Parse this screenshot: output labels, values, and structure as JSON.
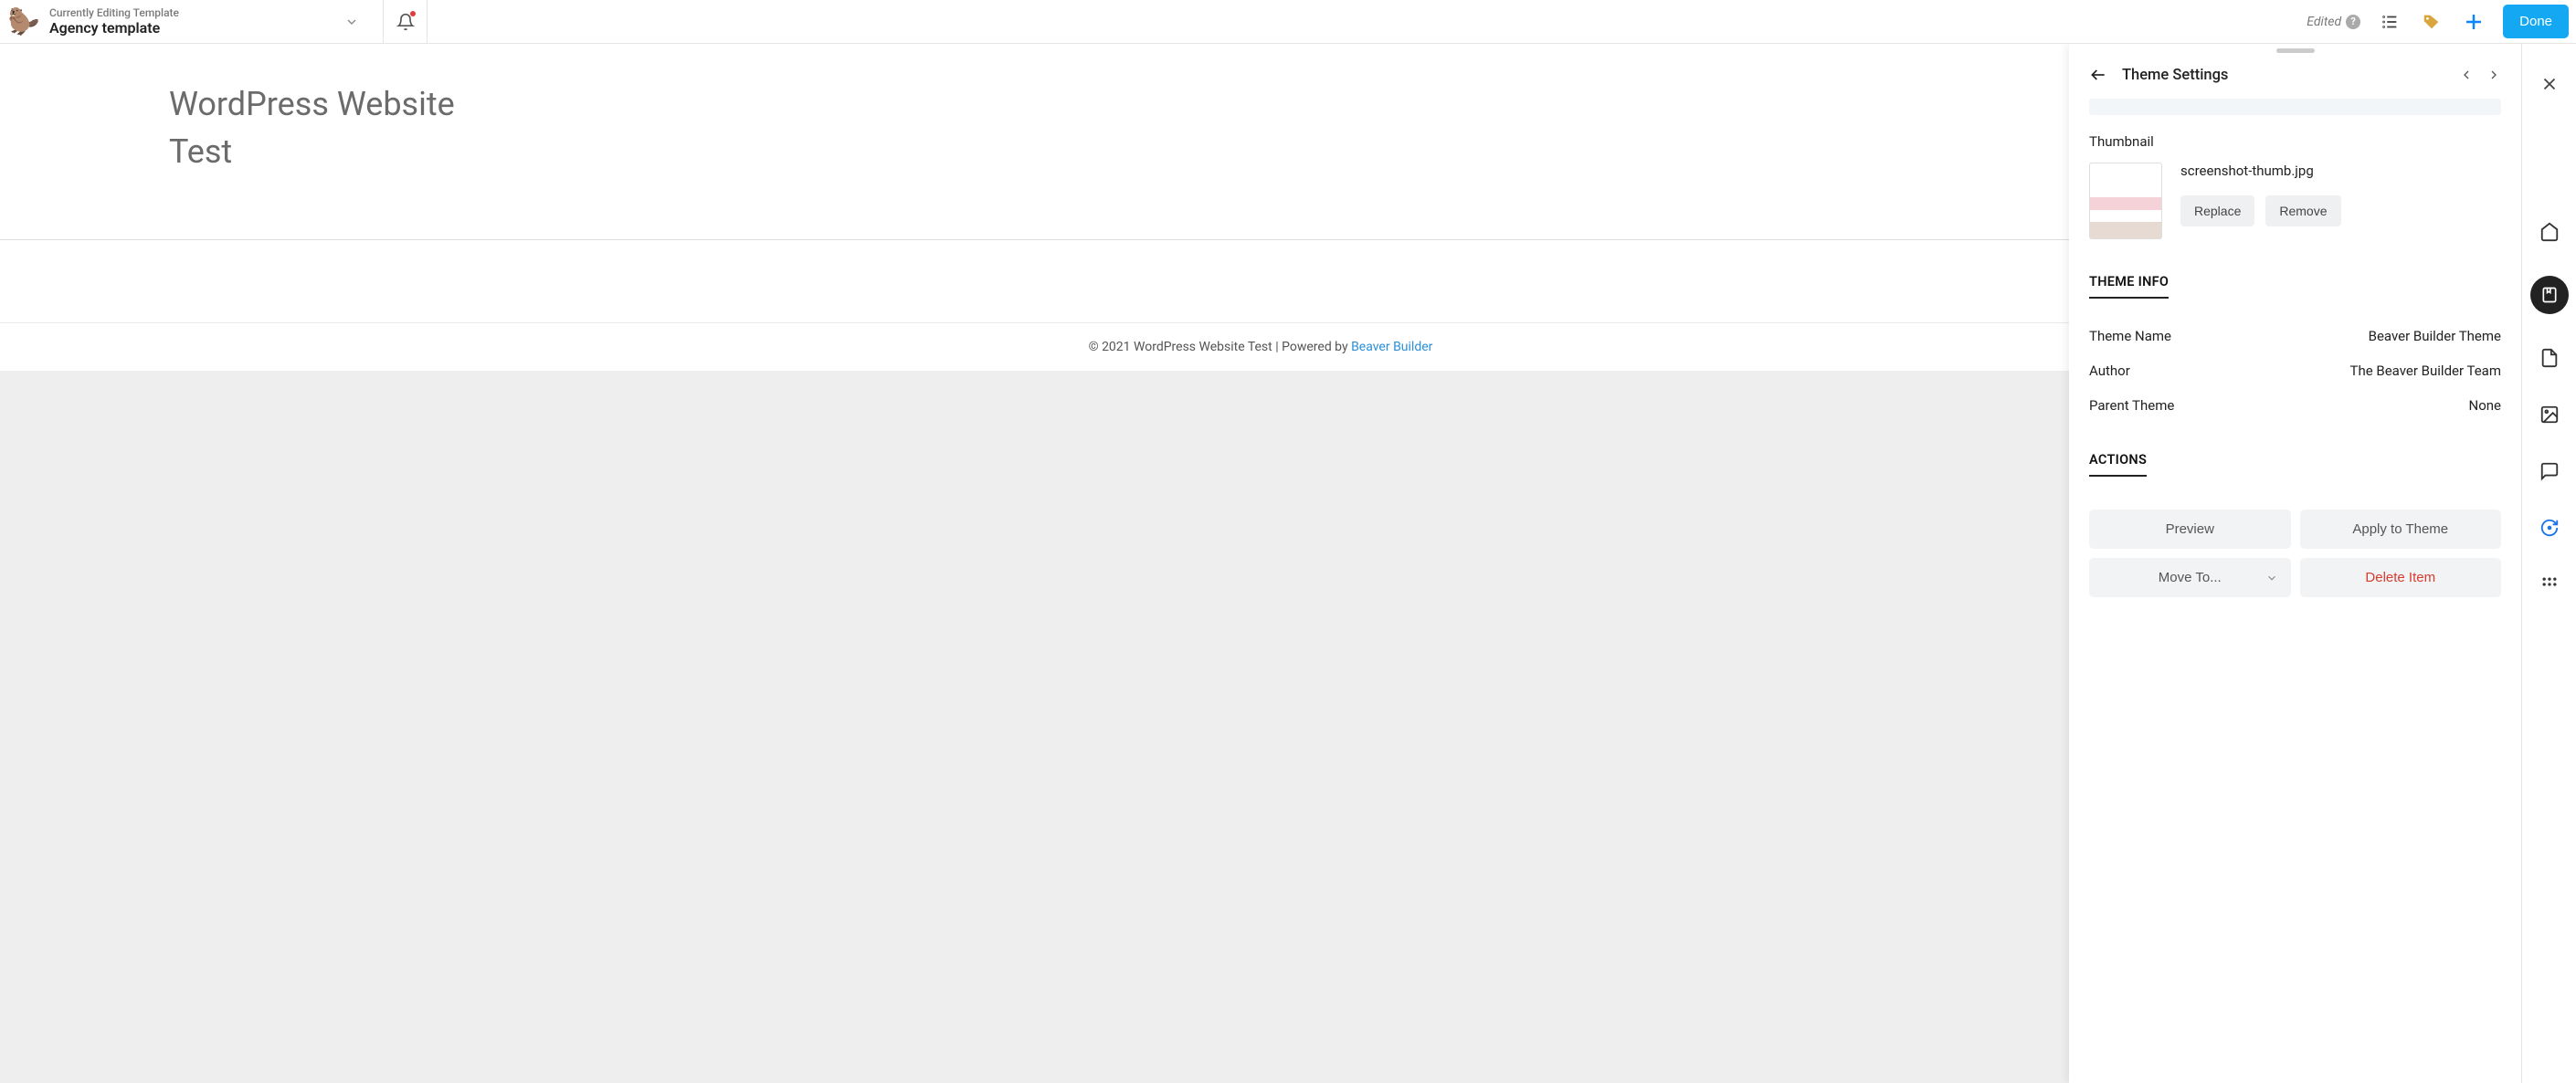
{
  "topbar": {
    "eyebrow": "Currently Editing Template",
    "title": "Agency template",
    "edited_label": "Edited",
    "done_label": "Done"
  },
  "preview": {
    "heading_line1": "WordPress Website",
    "heading_line2": "Test",
    "footer_text": "© 2021 WordPress Website Test | Powered by ",
    "footer_link": "Beaver Builder"
  },
  "panel": {
    "title": "Theme Settings",
    "thumbnail_label": "Thumbnail",
    "thumb_filename": "screenshot-thumb.jpg",
    "replace_label": "Replace",
    "remove_label": "Remove",
    "theme_info_heading": "THEME INFO",
    "rows": {
      "theme_name_key": "Theme Name",
      "theme_name_val": "Beaver Builder Theme",
      "author_key": "Author",
      "author_val": "The Beaver Builder Team",
      "parent_key": "Parent Theme",
      "parent_val": "None"
    },
    "actions_heading": "ACTIONS",
    "actions": {
      "preview": "Preview",
      "apply": "Apply to Theme",
      "move": "Move To...",
      "delete": "Delete Item"
    }
  }
}
